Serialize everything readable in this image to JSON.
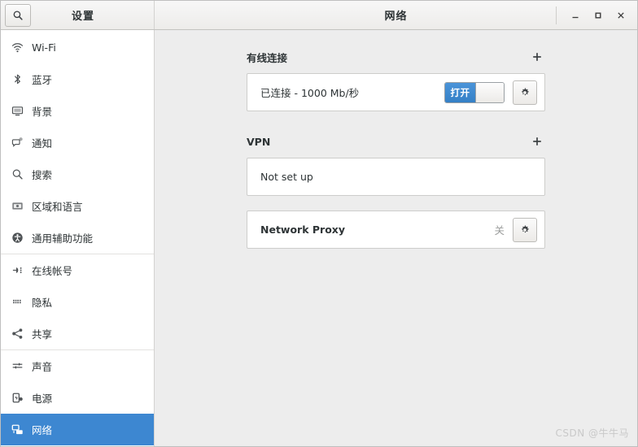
{
  "window": {
    "left_title": "设置",
    "right_title": "网络",
    "controls": {
      "minimize": "minimize",
      "maximize": "maximize",
      "close": "close"
    },
    "search_icon": "search-icon"
  },
  "sidebar": {
    "items": [
      {
        "label": "Wi-Fi",
        "icon": "wifi-icon",
        "selected": false
      },
      {
        "label": "蓝牙",
        "icon": "bluetooth-icon",
        "selected": false
      },
      {
        "label": "背景",
        "icon": "monitor-icon",
        "selected": false
      },
      {
        "label": "通知",
        "icon": "notification-icon",
        "selected": false
      },
      {
        "label": "搜索",
        "icon": "search-icon",
        "selected": false
      },
      {
        "label": "区域和语言",
        "icon": "keyboard-icon",
        "selected": false
      },
      {
        "label": "通用辅助功能",
        "icon": "accessibility-icon",
        "selected": false
      },
      {
        "label": "在线帐号",
        "icon": "online-accounts-icon",
        "selected": false
      },
      {
        "label": "隐私",
        "icon": "privacy-icon",
        "selected": false
      },
      {
        "label": "共享",
        "icon": "share-icon",
        "selected": false
      },
      {
        "label": "声音",
        "icon": "sound-icon",
        "selected": false
      },
      {
        "label": "电源",
        "icon": "power-icon",
        "selected": false
      },
      {
        "label": "网络",
        "icon": "network-icon",
        "selected": true
      }
    ]
  },
  "content": {
    "wired": {
      "title": "有线连接",
      "add_label": "+",
      "status": "已连接 - 1000 Mb/秒",
      "switch_label": "打开",
      "settings_icon": "gear-icon"
    },
    "vpn": {
      "title": "VPN",
      "add_label": "+",
      "status": "Not set up"
    },
    "proxy": {
      "title": "Network Proxy",
      "status": "关",
      "settings_icon": "gear-icon"
    }
  },
  "watermark": "CSDN @牛牛马",
  "colors": {
    "accent": "#3d87d1",
    "switch_on": "#3580c6",
    "content_bg": "#ededed",
    "text": "#2e3436"
  }
}
